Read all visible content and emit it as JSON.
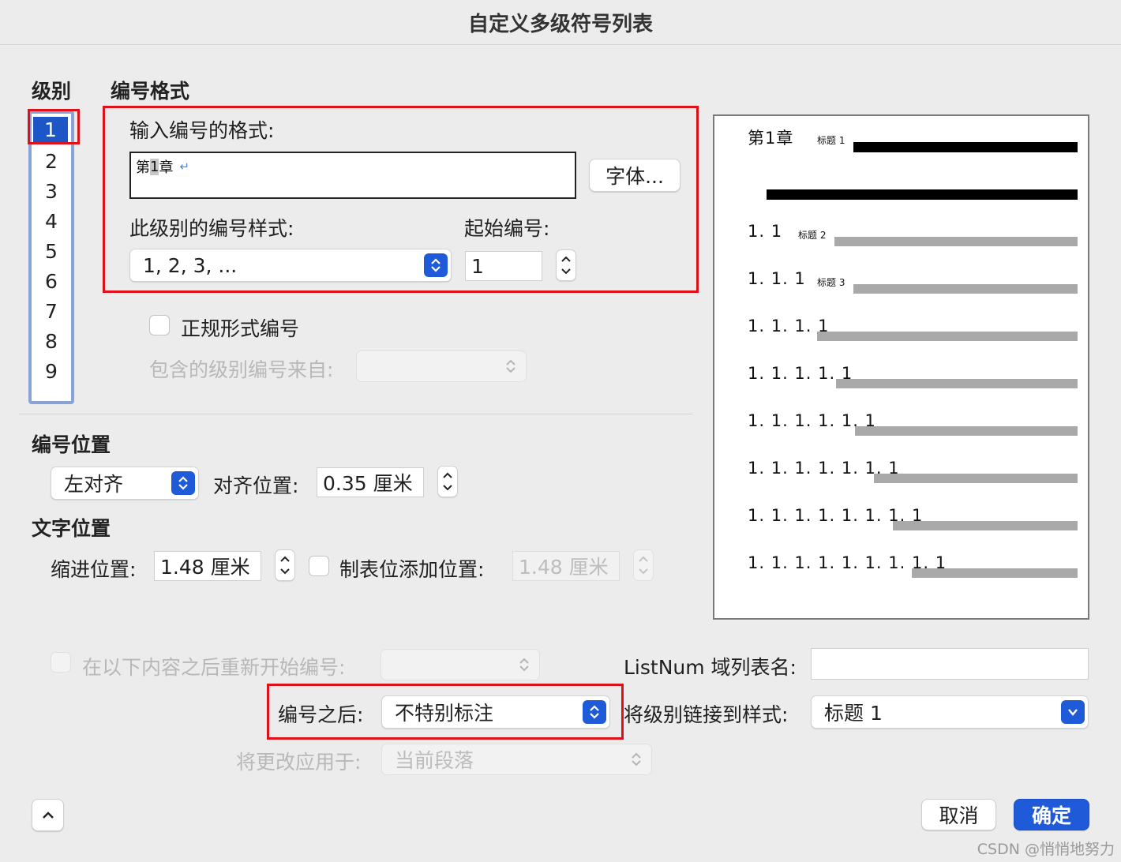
{
  "window": {
    "title": "自定义多级符号列表"
  },
  "levels": {
    "title": "级别",
    "items": [
      "1",
      "2",
      "3",
      "4",
      "5",
      "6",
      "7",
      "8",
      "9"
    ],
    "selected": "1"
  },
  "number_format": {
    "title": "编号格式",
    "enter_format_label": "输入编号的格式:",
    "format_value_prefix": "第",
    "format_value_number": "1",
    "format_value_suffix": "章",
    "font_button": "字体...",
    "style_label": "此级别的编号样式:",
    "style_value": "1, 2, 3, ...",
    "start_label": "起始编号:",
    "start_value": "1",
    "legal_label": "正规形式编号",
    "include_label": "包含的级别编号来自:"
  },
  "number_position": {
    "title": "编号位置",
    "align_value": "左对齐",
    "align_at_label": "对齐位置:",
    "align_at_value": "0.35 厘米"
  },
  "text_position": {
    "title": "文字位置",
    "indent_label": "缩进位置:",
    "indent_value": "1.48 厘米",
    "tab_label": "制表位添加位置:",
    "tab_value": "1.48 厘米"
  },
  "bottom": {
    "restart_label": "在以下内容之后重新开始编号:",
    "listnum_label": "ListNum 域列表名:",
    "listnum_value": "",
    "follow_label": "编号之后:",
    "follow_value": "不特别标注",
    "link_label": "将级别链接到样式:",
    "link_value": "标题 1",
    "apply_label": "将更改应用于:",
    "apply_value": "当前段落"
  },
  "preview": {
    "items": [
      {
        "num": "第1章",
        "caption": "标题 1"
      },
      {
        "num": "1. 1",
        "caption": "标题 2"
      },
      {
        "num": "1. 1. 1",
        "caption": "标题 3"
      },
      {
        "num": "1. 1. 1. 1",
        "caption": ""
      },
      {
        "num": "1. 1. 1. 1. 1",
        "caption": ""
      },
      {
        "num": "1. 1. 1. 1. 1. 1",
        "caption": ""
      },
      {
        "num": "1. 1. 1. 1. 1. 1. 1",
        "caption": ""
      },
      {
        "num": "1. 1. 1. 1. 1. 1. 1. 1",
        "caption": ""
      },
      {
        "num": "1. 1. 1. 1. 1. 1. 1. 1. 1",
        "caption": ""
      }
    ]
  },
  "buttons": {
    "cancel": "取消",
    "ok": "确定"
  },
  "icons": {
    "collapse": "chevron-up-icon",
    "popup": "up-down-arrows-icon",
    "stepper": "stepper-arrows-icon",
    "dropdown": "chevron-down-icon",
    "return": "return-arrow-icon"
  },
  "colors": {
    "accent": "#1f5ad8",
    "highlight_box": "#e0101a",
    "selection": "#1d56c6"
  },
  "watermark": "CSDN @悄悄地努力"
}
